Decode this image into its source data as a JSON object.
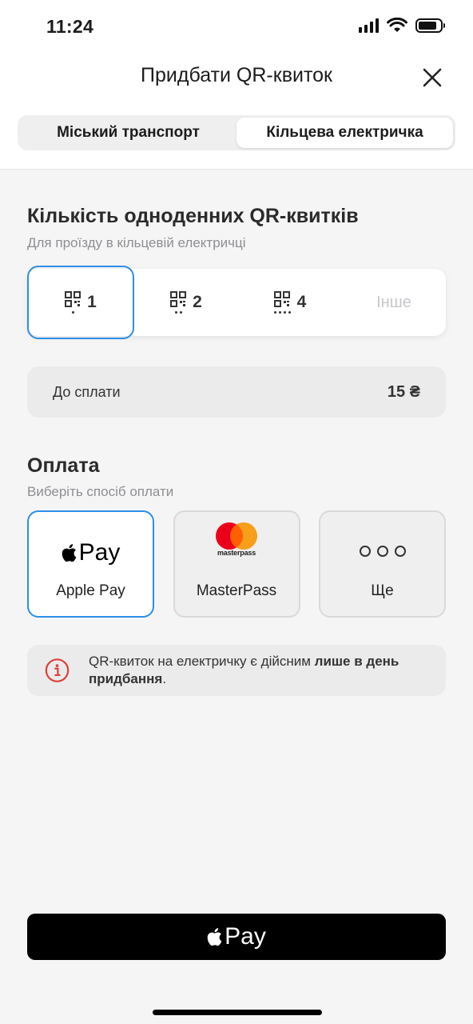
{
  "status_bar": {
    "time": "11:24"
  },
  "header": {
    "title": "Придбати QR-квиток"
  },
  "tabs": [
    {
      "label": "Міський транспорт",
      "active": false
    },
    {
      "label": "Кільцева електричка",
      "active": true
    }
  ],
  "quantity": {
    "title": "Кількість одноденних QR-квитків",
    "subtitle": "Для проїзду в кільцевій електричці",
    "options": [
      {
        "label": "1",
        "icon": "qr-icon",
        "selected": true
      },
      {
        "label": "2",
        "icon": "qr-icon",
        "selected": false
      },
      {
        "label": "4",
        "icon": "qr-icon",
        "selected": false
      },
      {
        "label": "Інше",
        "selected": false
      }
    ]
  },
  "to_pay": {
    "label": "До сплати",
    "amount": "15 ₴"
  },
  "payment": {
    "title": "Оплата",
    "subtitle": "Виберіть спосіб оплати",
    "methods": [
      {
        "label": "Apple Pay",
        "logo_text": "Pay",
        "icon": "apple-pay-icon",
        "selected": true
      },
      {
        "label": "MasterPass",
        "logo_text": "masterpass",
        "icon": "masterpass-icon",
        "selected": false
      },
      {
        "label": "Ще",
        "icon": "more-icon",
        "selected": false
      }
    ]
  },
  "info": {
    "text_before": "QR-квиток на електричку є дійсним ",
    "text_bold": "лише в день придбання",
    "text_after": "."
  },
  "apple_pay_button": {
    "label": "Pay"
  },
  "colors": {
    "accent": "#2e8ee6",
    "info_red": "#e0403a",
    "mastercard_red": "#eb001b",
    "mastercard_orange": "#f79e1b"
  }
}
